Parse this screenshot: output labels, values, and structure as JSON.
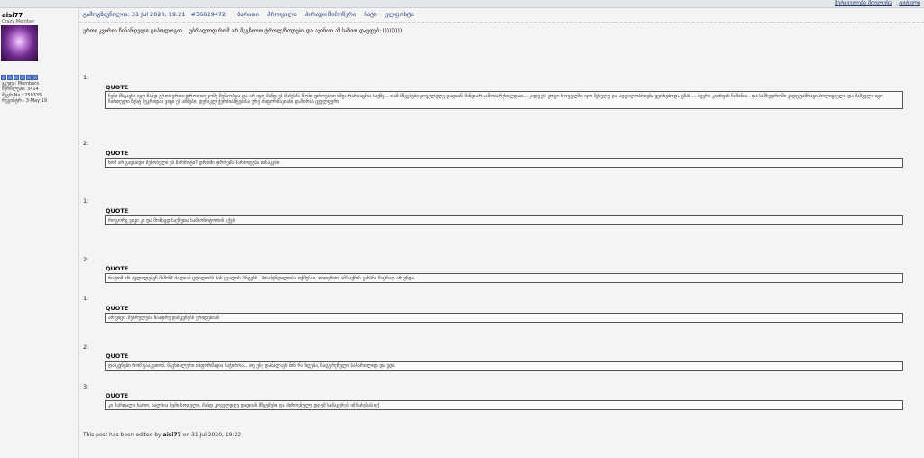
{
  "top_links": [
    "მეტყველება მოვლენა",
    "ტიტული"
  ],
  "user": {
    "name": "aisi77",
    "title": "Crazy Member",
    "group": "ჯგუფი: Members",
    "posts": "წერილები: 3414",
    "member_no": "მეგრ No.: 250335",
    "registered": "რეგისტრ.: 3-May 19"
  },
  "post": {
    "meta": "გამოგზავნილია: 31 Jul 2020, 19:21",
    "id": "#56629472",
    "links": [
      "ბარათი",
      "პროფილი",
      "პირადი მიმოწერა",
      "ჩატი",
      "ელფოსტა"
    ],
    "intro": "ერთი კვირის წინანდელი ტიპოლოგია ...უბრალოდ რომ არ მეგზიოთ ტროლ/ზოდები და ავინით ამ საზით დავფებ: )))))))))"
  },
  "quote_label": "QUOTE",
  "quotes": [
    {
      "num": "1:",
      "text": "ჩემი მსგავსი იყო მანდ ერთი ერთი დროთით ვომე მუშაობდა და არ იყო მანდ ეს მანქანა წოში დროებით ხშუა რარიაცმია საქმე... თამ მწყემები კოველდღე დადიან მანდ არ ჯაშოსარეხილდათ... კიდე ეს გოგო სოფელში იყო მეხელე და ადგილობრივმა ვეთხვბოდა გზას ... ბევრი კითხვის ნიშანია . და სამხედროში კიდე უამრავი პოლიციელი და მაშველი იყო ჩართული ზუსტ შეკრიდან ვიცი ეს ამბები. დენიკლ ქერძიანტებისა ურე ინფორმაციასი დამირჩა ცეულფერი"
    },
    {
      "num": "2:",
      "text": "ხომ არ გადაიდი მეზობელი ეს მარმოტი? დროში დროებს მარმოტება იხსაკები"
    },
    {
      "num": "1:",
      "text": "როგორც ვიცი კი და მოზავდ საქმეთა სამიონოტორის აქვს"
    },
    {
      "num": "2:",
      "text": "რატომ არ ავლილებენ მაშინ? ძალიან ცდილობს მის ცვალის პრცესს...მთაბუნდილობა ოქმენაი, თითეროს ამ საქმის გახსნა მაგრად არ უნდა"
    },
    {
      "num": "1:",
      "text": "არ ვიცი ,შესრულება ზაადრუ დასკვნებს ერიდებიან"
    },
    {
      "num": "2:",
      "text": "დასკვნები რომ გააკეთონ, მაცხიალური ინფორმაცია საჭიროა... თუ ესე დამალავს შინ რა ხდება, ჩადგრემული სამართლიდ და ვდა"
    },
    {
      "num": "3:",
      "text": "კი მართალი ხარო, ხალხია ჩემი სოფელი, მანდ კოველდღე დადიან მწყემები და პიროვნულე დღემ ჩამავერებ იმ ნახებას იქ"
    }
  ],
  "footer": {
    "prefix": "This post has been edited by",
    "editor": "aisi77",
    "suffix": "on 31 Jul 2020, 19:22"
  }
}
